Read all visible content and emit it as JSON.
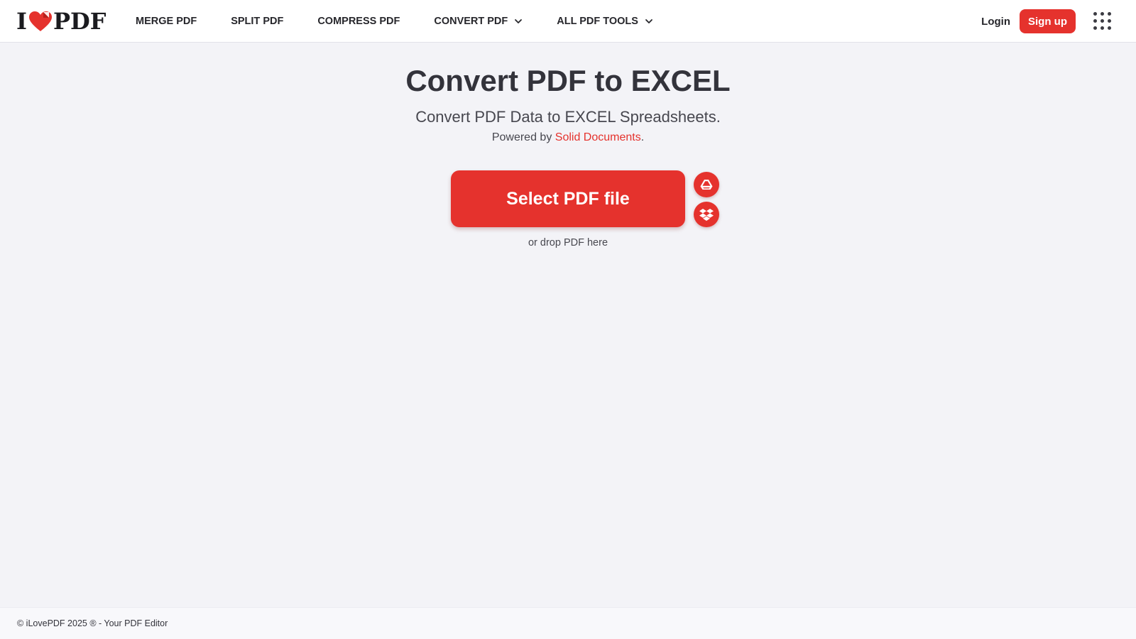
{
  "brand": {
    "logo_left": "I",
    "logo_right": "PDF",
    "accent_color": "#e5322d"
  },
  "nav": {
    "items": [
      {
        "label": "MERGE PDF",
        "dropdown": false
      },
      {
        "label": "SPLIT PDF",
        "dropdown": false
      },
      {
        "label": "COMPRESS PDF",
        "dropdown": false
      },
      {
        "label": "CONVERT PDF",
        "dropdown": true
      },
      {
        "label": "ALL PDF TOOLS",
        "dropdown": true
      }
    ]
  },
  "header": {
    "login_label": "Login",
    "signup_label": "Sign up",
    "apps_icon": "grid-apps-icon"
  },
  "main": {
    "title": "Convert PDF to EXCEL",
    "subtitle": "Convert PDF Data to EXCEL Spreadsheets.",
    "powered_prefix": "Powered by ",
    "powered_link": "Solid Documents",
    "powered_suffix": ".",
    "select_button": "Select PDF file",
    "drop_hint": "or drop PDF here",
    "cloud_icons": [
      "google-drive-icon",
      "dropbox-icon"
    ]
  },
  "footer": {
    "text": "© iLovePDF 2025 ® - Your PDF Editor"
  }
}
